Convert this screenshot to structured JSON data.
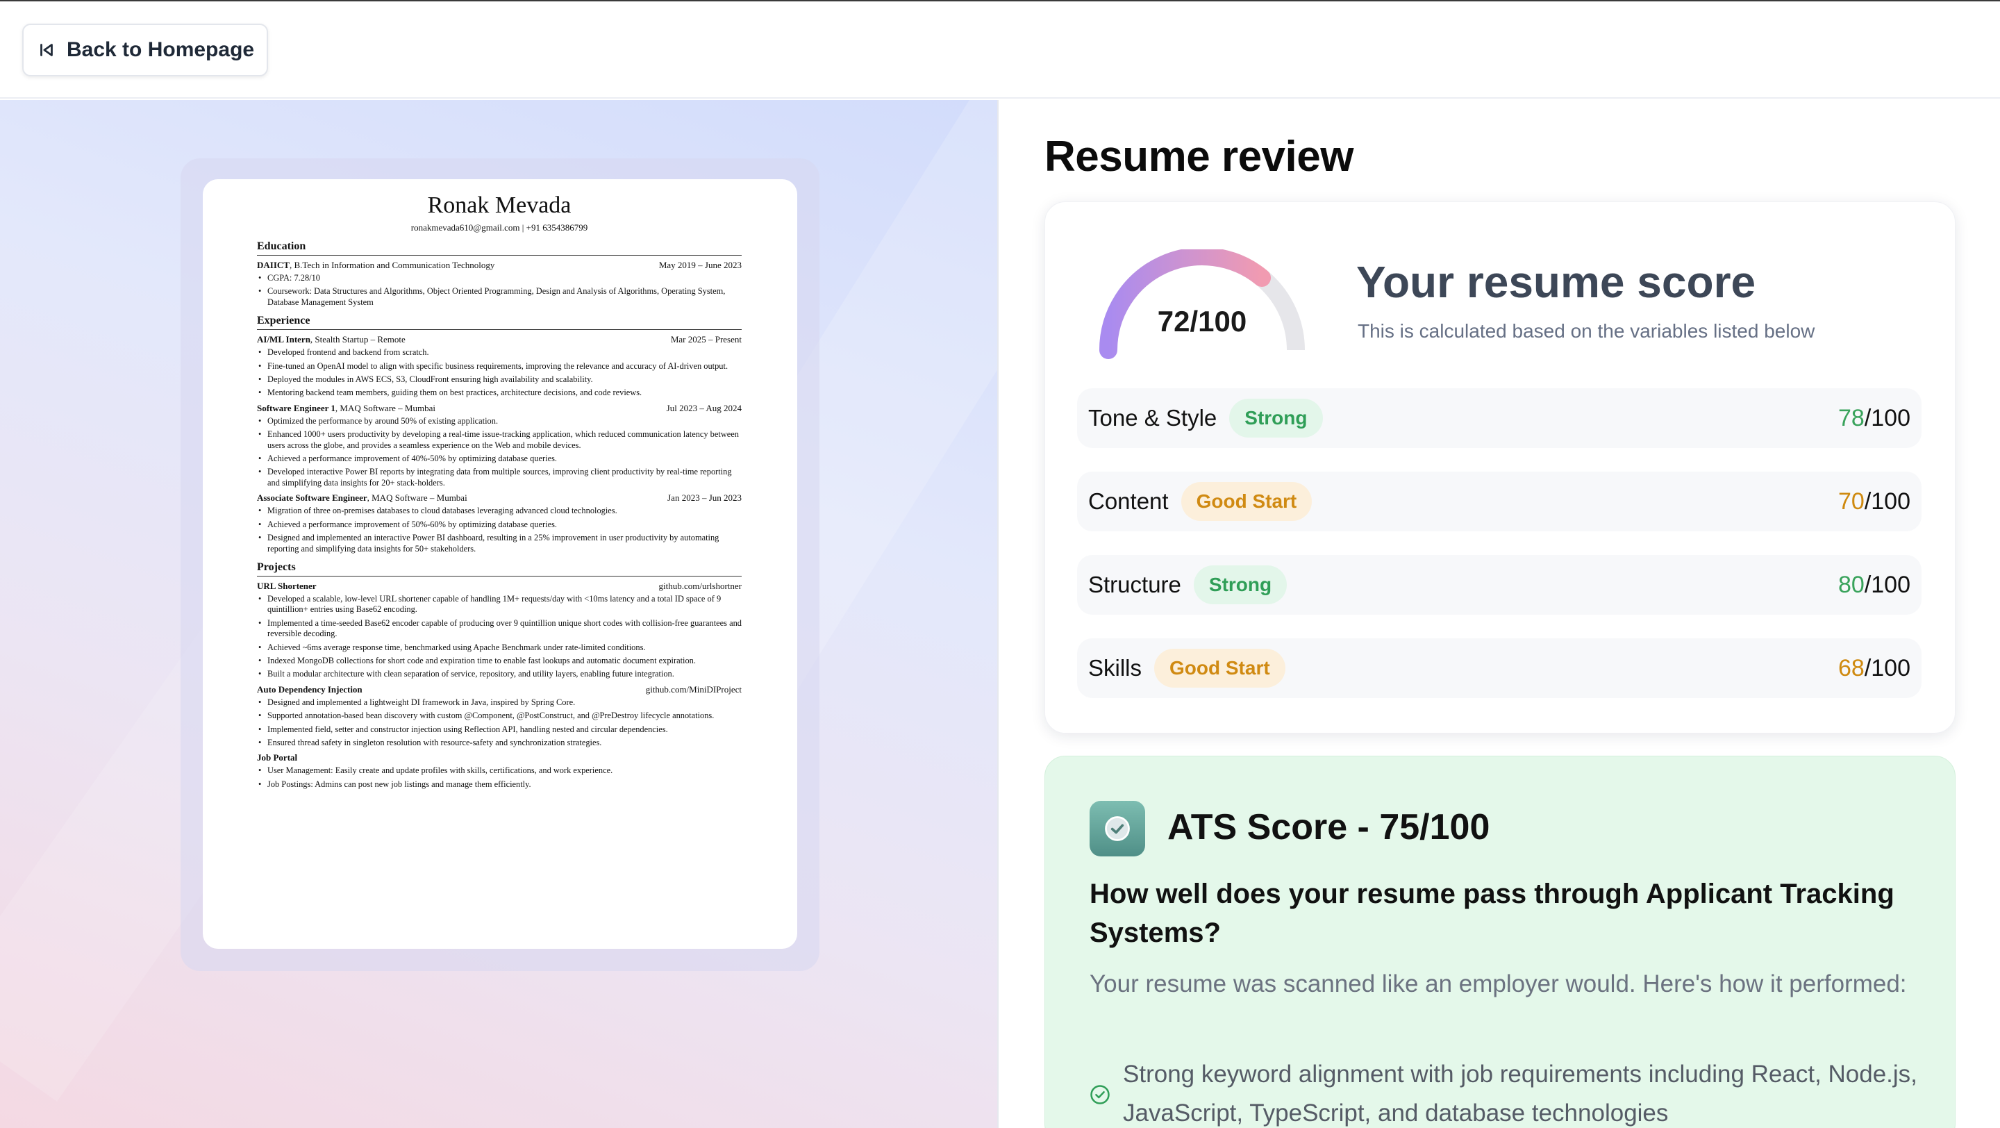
{
  "header": {
    "back_label": "Back to Homepage",
    "back_icon": "skip-back-icon"
  },
  "page_title": "Resume review",
  "score_card": {
    "score_value": 72,
    "score_max": 100,
    "gauge_label": "72/100",
    "title": "Your resume score",
    "subtitle": "This is calculated based on the variables listed below",
    "gauge_colors": {
      "start": "#a98bf0",
      "end": "#f19bb1",
      "track": "#e6e6ea"
    },
    "categories": [
      {
        "name": "Tone & Style",
        "badge": "Strong",
        "score": "78",
        "max": "/100",
        "level": "strong"
      },
      {
        "name": "Content",
        "badge": "Good Start",
        "score": "70",
        "max": "/100",
        "level": "good"
      },
      {
        "name": "Structure",
        "badge": "Strong",
        "score": "80",
        "max": "/100",
        "level": "strong"
      },
      {
        "name": "Skills",
        "badge": "Good Start",
        "score": "68",
        "max": "/100",
        "level": "good"
      }
    ]
  },
  "ats": {
    "icon": "check-badge-icon",
    "title": "ATS Score - 75/100",
    "question": "How well does your resume pass through Applicant Tracking Systems?",
    "description": "Your resume was scanned like an employer would. Here's how it performed:",
    "items": [
      "Strong keyword alignment with job requirements including React, Node.js, JavaScript, TypeScript, and database technologies"
    ]
  },
  "resume": {
    "name": "Ronak Mevada",
    "contact": "ronakmevada610@gmail.com  |  +91 6354386799",
    "sections": [
      {
        "title": "Education",
        "entries": [
          {
            "org": "DAIICT",
            "role": ", B.Tech in Information and Communication Technology",
            "date": "May 2019 – June 2023",
            "bullets": [
              "CGPA: 7.28/10",
              "Coursework: Data Structures and Algorithms, Object Oriented Programming, Design and Analysis of Algorithms, Operating System, Database Management System"
            ]
          }
        ]
      },
      {
        "title": "Experience",
        "entries": [
          {
            "org": "AI/ML Intern",
            "role": ", Stealth Startup – Remote",
            "date": "Mar 2025 – Present",
            "bullets": [
              "Developed frontend and backend from scratch.",
              "Fine-tuned an OpenAI model to align with specific business requirements, improving the relevance and accuracy of AI-driven output.",
              "Deployed the modules in AWS ECS, S3, CloudFront ensuring high availability and scalability.",
              "Mentoring backend team members, guiding them on best practices, architecture decisions, and code reviews."
            ]
          },
          {
            "org": "Software Engineer 1",
            "role": ", MAQ Software – Mumbai",
            "date": "Jul 2023 – Aug 2024",
            "bullets": [
              "Optimized the performance by around 50% of existing application.",
              "Enhanced 1000+ users productivity by developing a real-time issue-tracking application, which reduced communication latency between users across the globe, and provides a seamless experience on the Web and mobile devices.",
              "Achieved a performance improvement of 40%-50% by optimizing database queries.",
              "Developed interactive Power BI reports by integrating data from multiple sources, improving client productivity by real-time reporting and simplifying data insights for 20+ stack-holders."
            ]
          },
          {
            "org": "Associate Software Engineer",
            "role": ", MAQ Software – Mumbai",
            "date": "Jan 2023 – Jun 2023",
            "bullets": [
              "Migration of three on-premises databases to cloud databases leveraging advanced cloud technologies.",
              "Achieved a performance improvement of 50%-60% by optimizing database queries.",
              "Designed and implemented an interactive Power BI dashboard, resulting in a 25% improvement in user productivity by automating reporting and simplifying data insights for 50+ stakeholders."
            ]
          }
        ]
      },
      {
        "title": "Projects",
        "entries": [
          {
            "org": "URL Shortener",
            "role": "",
            "date": "github.com/urlshortner",
            "bullets": [
              "Developed a scalable, low-level URL shortener capable of handling 1M+ requests/day with <10ms latency and a total ID space of 9 quintillion+ entries using Base62 encoding.",
              "Implemented a time-seeded Base62 encoder capable of producing over 9 quintillion unique short codes with collision-free guarantees and reversible decoding.",
              "Achieved ~6ms average response time, benchmarked using Apache Benchmark under rate-limited conditions.",
              "Indexed MongoDB collections for short code and expiration time to enable fast lookups and automatic document expiration.",
              "Built a modular architecture with clean separation of service, repository, and utility layers, enabling future integration."
            ]
          },
          {
            "org": "Auto Dependency Injection",
            "role": "",
            "date": "github.com/MiniDIProject",
            "bullets": [
              "Designed and implemented a lightweight DI framework in Java, inspired by Spring Core.",
              "Supported annotation-based bean discovery with custom @Component, @PostConstruct, and @PreDestroy lifecycle annotations.",
              "Implemented field, setter and constructor injection using Reflection API, handling nested and circular dependencies.",
              "Ensured thread safety in singleton resolution with resource-safety and synchronization strategies."
            ]
          },
          {
            "org": "Job Portal",
            "role": "",
            "date": "",
            "bullets": [
              "User Management: Easily create and update profiles with skills, certifications, and work experience.",
              "Job Postings: Admins can post new job listings and manage them efficiently."
            ]
          }
        ]
      }
    ]
  }
}
